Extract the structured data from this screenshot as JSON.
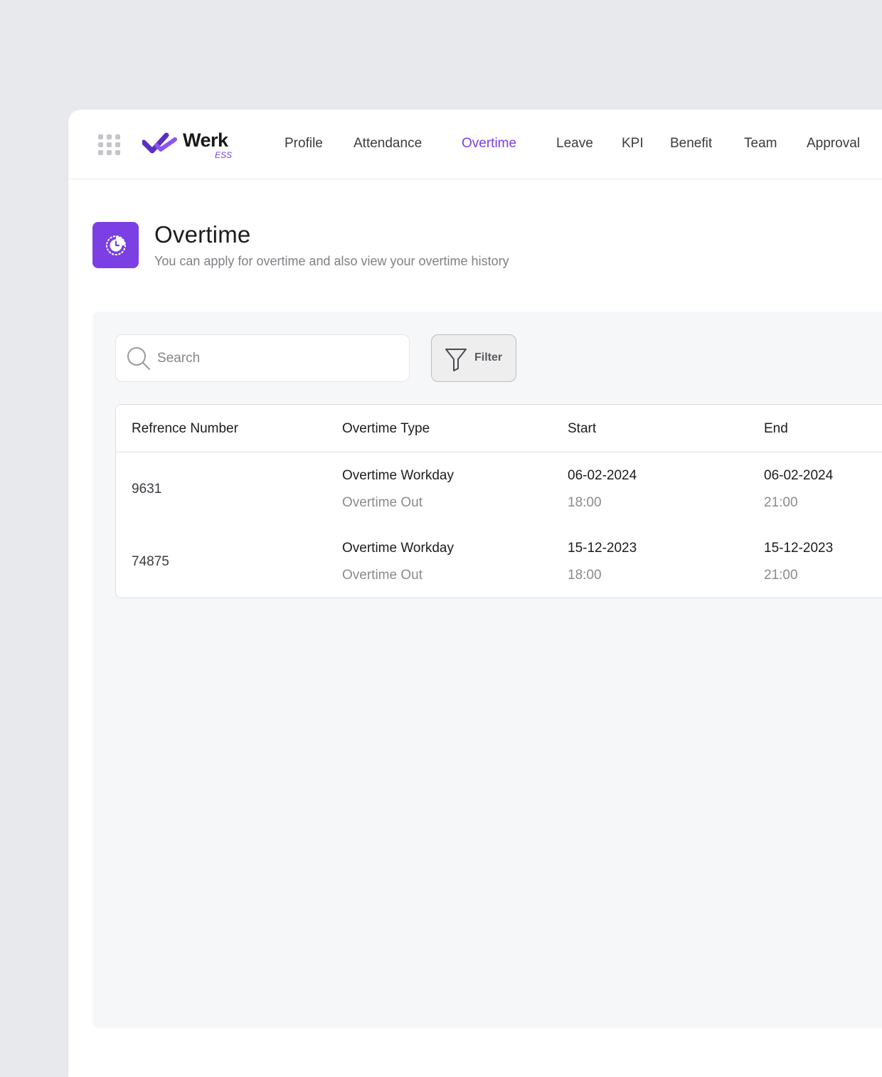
{
  "brand": {
    "name": "Werk",
    "sub": "ESS",
    "accent": "#7b3fe4"
  },
  "nav": {
    "items": [
      {
        "label": "Profile"
      },
      {
        "label": "Attendance"
      },
      {
        "label": "Overtime",
        "active": true
      },
      {
        "label": "Leave"
      },
      {
        "label": "KPI"
      },
      {
        "label": "Benefit"
      },
      {
        "label": "Team"
      },
      {
        "label": "Approval"
      }
    ]
  },
  "page": {
    "icon": "overtime-clock-icon",
    "title": "Overtime",
    "subtitle": "You can apply for overtime and also view your overtime history"
  },
  "toolbar": {
    "search_placeholder": "Search",
    "filter_label": "Filter"
  },
  "table": {
    "columns": [
      "Refrence Number",
      "Overtime Type",
      "Start",
      "End"
    ],
    "rows": [
      {
        "ref": "9631",
        "type": "Overtime Workday",
        "type_sub": "Overtime Out",
        "start_date": "06-02-2024",
        "start_time": "18:00",
        "end_date": "06-02-2024",
        "end_time": "21:00"
      },
      {
        "ref": "74875",
        "type": "Overtime Workday",
        "type_sub": "Overtime Out",
        "start_date": "15-12-2023",
        "start_time": "18:00",
        "end_date": "15-12-2023",
        "end_time": "21:00"
      }
    ]
  }
}
